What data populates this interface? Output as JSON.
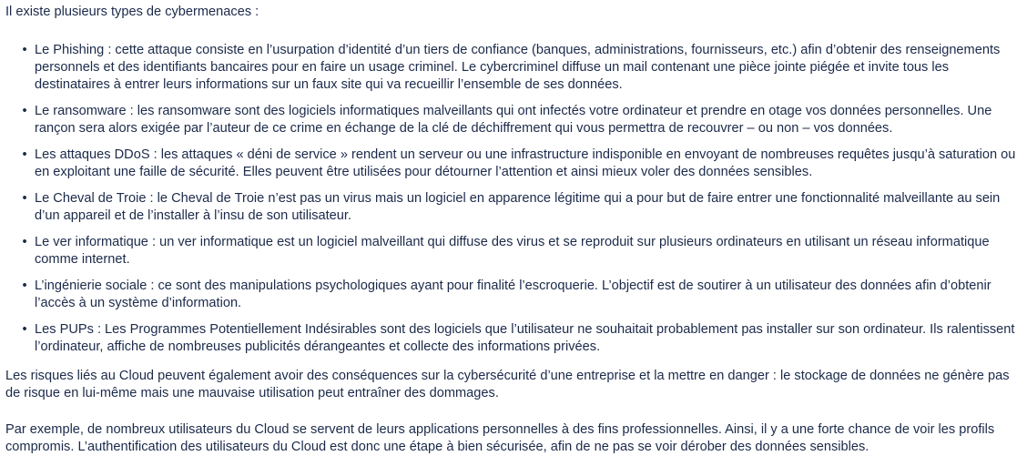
{
  "intro": "Il existe plusieurs types de cybermenaces :",
  "threats": [
    {
      "text": "Le Phishing : cette attaque consiste en l’usurpation d’identité d’un tiers de confiance (banques, administrations, fournisseurs, etc.) afin d’obtenir des renseignements personnels et des identifiants bancaires pour en faire un usage criminel. Le cybercriminel diffuse un mail contenant une pièce jointe piégée et invite tous les destinataires à entrer leurs informations sur un faux site qui va recueillir l’ensemble de ses données."
    },
    {
      "text": "Le ransomware : les ransomware sont des logiciels informatiques malveillants qui ont infectés votre ordinateur et prendre en otage vos données personnelles. Une rançon sera alors exigée par l’auteur de ce crime en échange de la clé de déchiffrement qui vous permettra de recouvrer – ou non – vos données."
    },
    {
      "text": "Les attaques DDoS : les attaques « déni de service » rendent un serveur ou une infrastructure indisponible en envoyant de nombreuses requêtes jusqu’à saturation ou en exploitant une faille de sécurité. Elles peuvent être utilisées pour détourner l’attention et ainsi mieux voler des données sensibles."
    },
    {
      "text": "Le Cheval de Troie : le Cheval de Troie n’est pas un virus mais un logiciel en apparence légitime qui a pour but de faire entrer une fonctionnalité malveillante au sein d’un appareil et de l’installer à l’insu de son utilisateur."
    },
    {
      "text": "Le ver informatique : un ver informatique est un logiciel malveillant qui diffuse des virus et se reproduit sur plusieurs ordinateurs en utilisant un réseau informatique comme internet."
    },
    {
      "text": "L’ingénierie sociale : ce sont des manipulations psychologiques ayant pour finalité l’escroquerie. L’objectif est de soutirer à un utilisateur des données afin d’obtenir l’accès à un système d’information."
    },
    {
      "text": "Les PUPs : Les Programmes Potentiellement Indésirables sont des logiciels que l’utilisateur ne souhaitait probablement pas installer sur son ordinateur. Ils ralentissent l’ordinateur, affiche de nombreuses publicités dérangeantes et collecte des informations privées."
    }
  ],
  "bullet_glyph": "•",
  "paragraphs": [
    "Les risques liés au Cloud peuvent également avoir des conséquences sur la cybersécurité d’une entreprise et la mettre en danger : le stockage de données ne génère pas de risque en lui-même mais une mauvaise utilisation peut entraîner des dommages.",
    "Par exemple, de nombreux utilisateurs du Cloud se servent de leurs applications personnelles à des fins professionnelles. Ainsi, il y a une forte chance de voir les profils compromis. L’authentification des utilisateurs du Cloud est donc une étape à bien sécurisée, afin de ne pas se voir dérober des données sensibles."
  ],
  "colors": {
    "text": "#1b2a4a",
    "background": "#ffffff"
  }
}
